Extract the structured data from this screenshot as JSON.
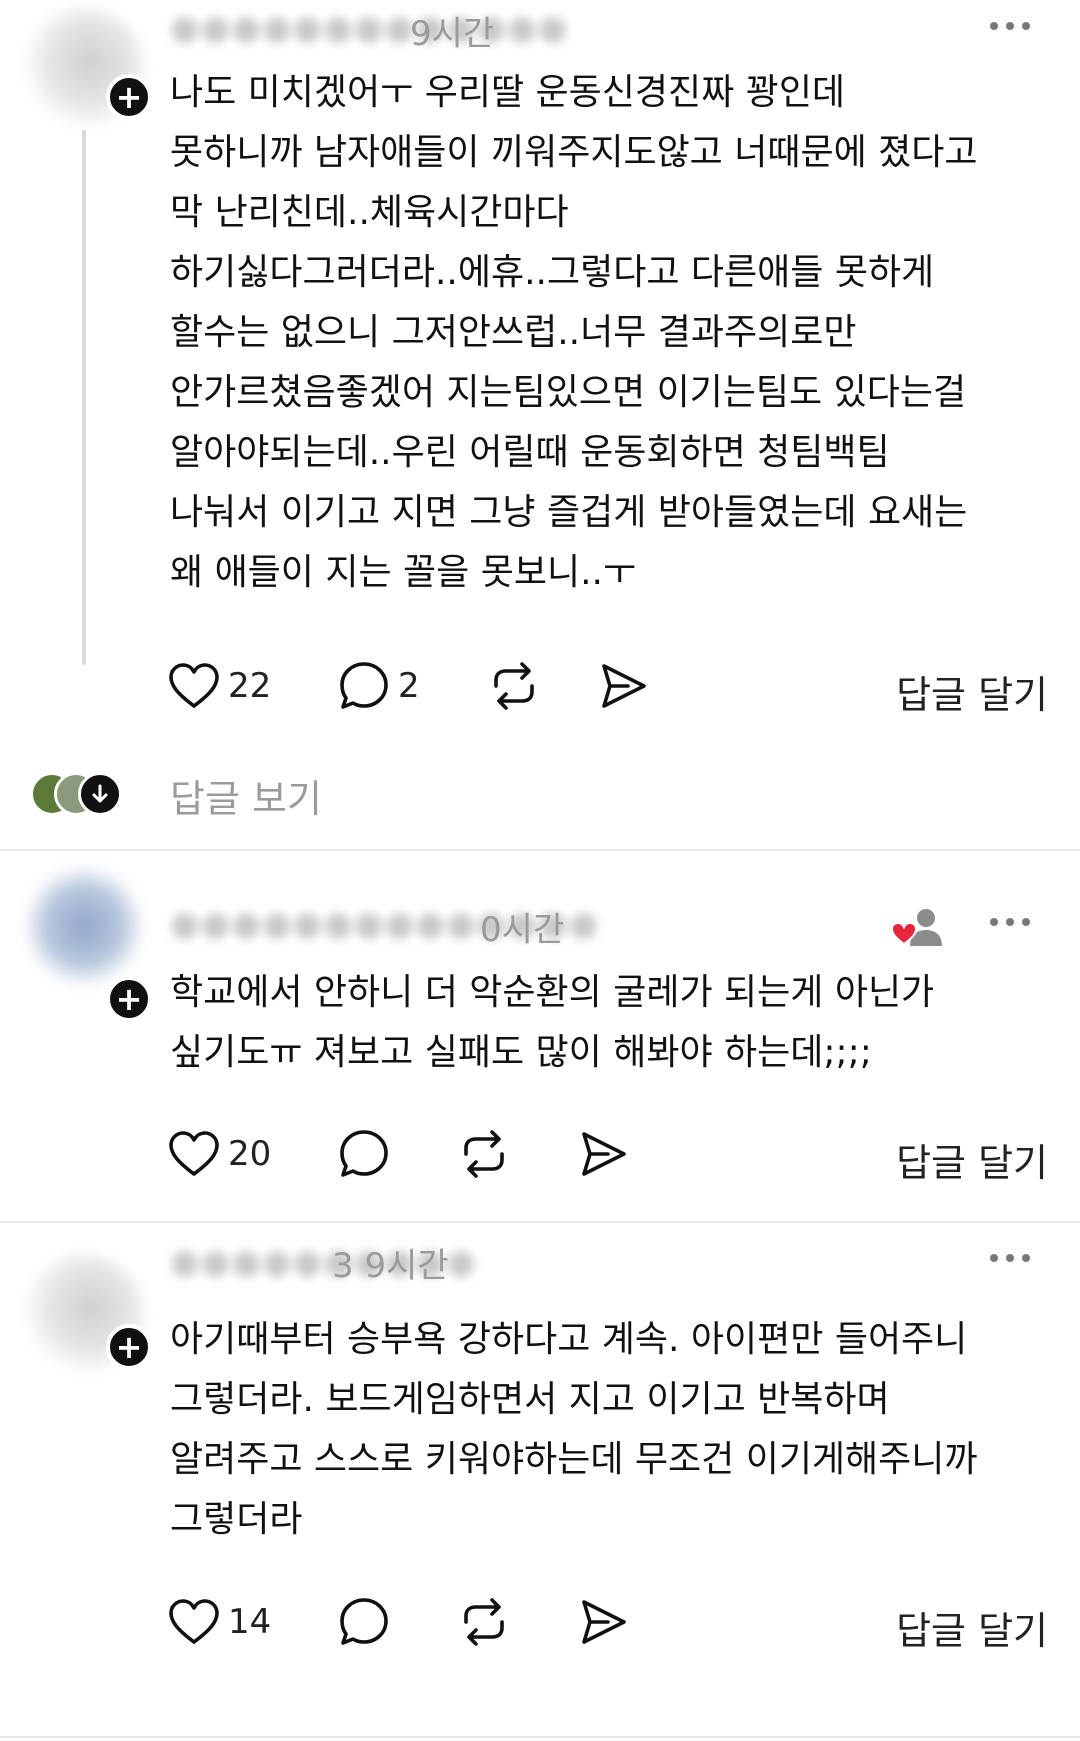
{
  "posts": [
    {
      "time": "9시간",
      "lines": [
        "나도 미치겠어ㅜ 우리딸 운동신경진짜 꽝인데",
        "못하니까 남자애들이 끼워주지도않고 너때문에 졌다고",
        "막 난리친데..체육시간마다",
        "하기싫다그러더라..에휴..그렇다고 다른애들 못하게",
        "할수는 없으니 그저안쓰럽..너무 결과주의로만",
        "안가르쳤음좋겠어 지는팀있으면 이기는팀도 있다는걸",
        "알아야되는데..우린 어릴때 운동회하면 청팀백팀",
        "나눠서 이기고 지면 그냥 즐겁게 받아들였는데 요새는",
        "왜 애들이 지는 꼴을 못보니..ㅜ"
      ],
      "likes": "22",
      "replies": "2",
      "reply_label": "답글 달기"
    },
    {
      "time": "0시간",
      "lines": [
        "학교에서 안하니 더 악순환의 굴레가 되는게 아닌가",
        "싶기도ㅠ 져보고 실패도 많이 해봐야 하는데;;;;"
      ],
      "likes": "20",
      "reply_label": "답글 달기"
    },
    {
      "time": "3 9시간",
      "lines": [
        "아기때부터 승부욕 강하다고 계속. 아이편만 들어주니",
        "그렇더라. 보드게임하면서 지고 이기고 반복하며",
        "알려주고 스스로 키워야하는데 무조건 이기게해주니까",
        "그렇더라"
      ],
      "likes": "14",
      "reply_label": "답글 달기"
    }
  ],
  "view_replies_label": "답글 보기",
  "icons": {
    "plus": "+",
    "heart": "heart-icon",
    "comment": "comment-icon",
    "repost": "repost-icon",
    "share": "share-icon",
    "more": "more-options-icon",
    "down_arrow": "arrow-down-icon",
    "liked_by_author": "liked-by-author-icon"
  },
  "colors": {
    "text": "#111111",
    "muted": "#9b9b9b",
    "divider": "#e8e8e8",
    "heart_red": "#e8253a"
  }
}
